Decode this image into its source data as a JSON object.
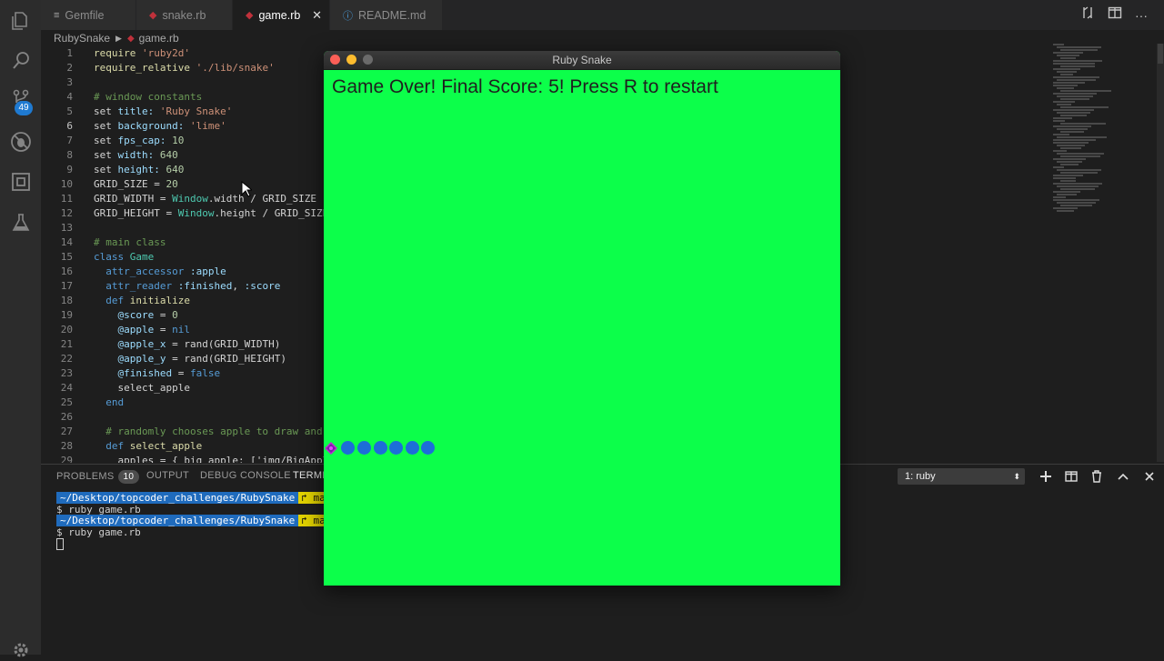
{
  "tabs": [
    {
      "label": "Gemfile",
      "icon": "list-icon"
    },
    {
      "label": "snake.rb",
      "icon": "ruby-icon"
    },
    {
      "label": "game.rb",
      "icon": "ruby-icon"
    },
    {
      "label": "README.md",
      "icon": "info-icon"
    }
  ],
  "breadcrumb": {
    "folder": "RubySnake",
    "file": "game.rb"
  },
  "activity": {
    "scm_badge": "49"
  },
  "code_lines": [
    {
      "n": "1",
      "html": "<span class='fn'>require</span> <span class='str'>'ruby2d'</span>"
    },
    {
      "n": "2",
      "html": "<span class='fn'>require_relative</span> <span class='str'>'./lib/snake'</span>"
    },
    {
      "n": "3",
      "html": ""
    },
    {
      "n": "4",
      "html": "<span class='cmt'># window constants</span>"
    },
    {
      "n": "5",
      "html": "set <span class='sym'>title:</span> <span class='str'>'Ruby Snake'</span>"
    },
    {
      "n": "6",
      "html": "set <span class='sym'>background:</span> <span class='str'>'lime'</span>"
    },
    {
      "n": "7",
      "html": "set <span class='sym'>fps_cap:</span> <span class='num'>10</span>"
    },
    {
      "n": "8",
      "html": "set <span class='sym'>width:</span> <span class='num'>640</span>"
    },
    {
      "n": "9",
      "html": "set <span class='sym'>height:</span> <span class='num'>640</span>"
    },
    {
      "n": "10",
      "html": "GRID_SIZE = <span class='num'>20</span>"
    },
    {
      "n": "11",
      "html": "GRID_WIDTH = <span class='cls'>Window</span>.width / GRID_SIZE"
    },
    {
      "n": "12",
      "html": "GRID_HEIGHT = <span class='cls'>Window</span>.height / GRID_SIZE"
    },
    {
      "n": "13",
      "html": ""
    },
    {
      "n": "14",
      "html": "<span class='cmt'># main class</span>"
    },
    {
      "n": "15",
      "html": "<span class='kw'>class</span> <span class='cls'>Game</span>"
    },
    {
      "n": "16",
      "html": "  <span class='kw'>attr_accessor</span> <span class='sym'>:apple</span>"
    },
    {
      "n": "17",
      "html": "  <span class='kw'>attr_reader</span> <span class='sym'>:finished</span>, <span class='sym'>:score</span>"
    },
    {
      "n": "18",
      "html": "  <span class='kw'>def</span> <span class='fn'>initialize</span>"
    },
    {
      "n": "19",
      "html": "    <span class='ivar'>@score</span> = <span class='num'>0</span>"
    },
    {
      "n": "20",
      "html": "    <span class='ivar'>@apple</span> = <span class='kw'>nil</span>"
    },
    {
      "n": "21",
      "html": "    <span class='ivar'>@apple_x</span> = rand(GRID_WIDTH)"
    },
    {
      "n": "22",
      "html": "    <span class='ivar'>@apple_y</span> = rand(GRID_HEIGHT)"
    },
    {
      "n": "23",
      "html": "    <span class='ivar'>@finished</span> = <span class='bool'>false</span>"
    },
    {
      "n": "24",
      "html": "    select_apple"
    },
    {
      "n": "25",
      "html": "  <span class='kw'>end</span>"
    },
    {
      "n": "26",
      "html": ""
    },
    {
      "n": "27",
      "html": "  <span class='cmt'># randomly chooses apple to draw and</span>"
    },
    {
      "n": "28",
      "html": "  <span class='kw'>def</span> <span class='fn'>select_apple</span>"
    },
    {
      "n": "29",
      "html": "    apples = { big_apple: ['img/BigAppl"
    }
  ],
  "panel": {
    "tabs": [
      "PROBLEMS",
      "OUTPUT",
      "DEBUG CONSOLE",
      "TERMINAL"
    ],
    "problems_count": "10",
    "terminal_select": "1: ruby",
    "terminal_lines": [
      {
        "path": "~/Desktop/topcoder_challenges/RubySnake",
        "branch": "↱ ma"
      },
      {
        "cmd": "$ ruby game.rb"
      },
      {
        "path": "~/Desktop/topcoder_challenges/RubySnake",
        "branch": "↱ ma"
      },
      {
        "cmd": "$ ruby game.rb"
      }
    ]
  },
  "game": {
    "title": "Ruby Snake",
    "message": "Game Over! Final Score: 5! Press R to restart",
    "background": "#0cff4a",
    "snake_color": "#1d6ed8",
    "apple_color": "#c026d3"
  },
  "colors": {
    "accent": "#1f7ad1",
    "editor_bg": "#1e1e1e"
  }
}
